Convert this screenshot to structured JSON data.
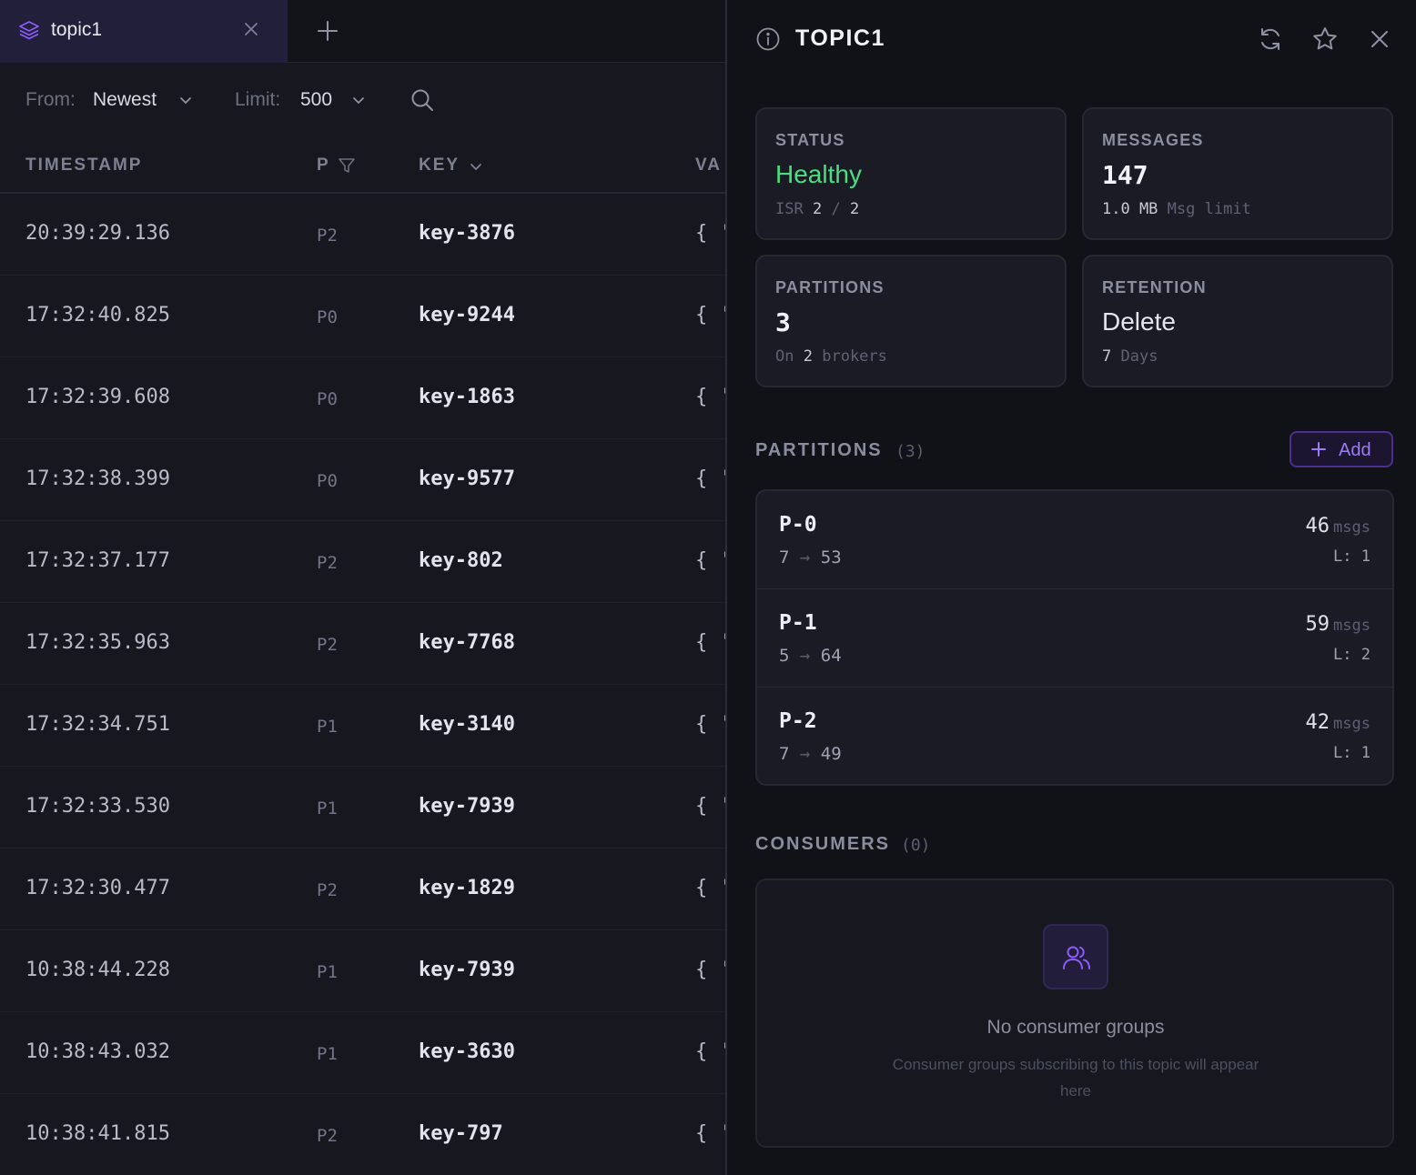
{
  "tab": {
    "label": "topic1"
  },
  "filters": {
    "from_label": "From:",
    "from_value": "Newest",
    "limit_label": "Limit:",
    "limit_value": "500"
  },
  "table": {
    "columns": [
      "TIMESTAMP",
      "P",
      "KEY",
      "VA"
    ],
    "rows": [
      {
        "timestamp": "20:39:29.136",
        "partition": "P2",
        "key": "key-3876",
        "value": "{ '"
      },
      {
        "timestamp": "17:32:40.825",
        "partition": "P0",
        "key": "key-9244",
        "value": "{ '"
      },
      {
        "timestamp": "17:32:39.608",
        "partition": "P0",
        "key": "key-1863",
        "value": "{ '"
      },
      {
        "timestamp": "17:32:38.399",
        "partition": "P0",
        "key": "key-9577",
        "value": "{ '"
      },
      {
        "timestamp": "17:32:37.177",
        "partition": "P2",
        "key": "key-802",
        "value": "{ '"
      },
      {
        "timestamp": "17:32:35.963",
        "partition": "P2",
        "key": "key-7768",
        "value": "{ '"
      },
      {
        "timestamp": "17:32:34.751",
        "partition": "P1",
        "key": "key-3140",
        "value": "{ '"
      },
      {
        "timestamp": "17:32:33.530",
        "partition": "P1",
        "key": "key-7939",
        "value": "{ '"
      },
      {
        "timestamp": "17:32:30.477",
        "partition": "P2",
        "key": "key-1829",
        "value": "{ '"
      },
      {
        "timestamp": "10:38:44.228",
        "partition": "P1",
        "key": "key-7939",
        "value": "{ '"
      },
      {
        "timestamp": "10:38:43.032",
        "partition": "P1",
        "key": "key-3630",
        "value": "{ '"
      },
      {
        "timestamp": "10:38:41.815",
        "partition": "P2",
        "key": "key-797",
        "value": "{ '"
      }
    ]
  },
  "panel": {
    "title": "TOPIC1",
    "status": {
      "label": "STATUS",
      "value": "Healthy",
      "isr_label": "ISR",
      "isr_in": "2",
      "isr_sep": "/",
      "isr_total": "2"
    },
    "messages": {
      "label": "MESSAGES",
      "value": "147",
      "limit_value": "1.0 MB",
      "limit_label": "Msg limit"
    },
    "partitions_card": {
      "label": "PARTITIONS",
      "value": "3",
      "on_label": "On",
      "brokers": "2",
      "brokers_label": "brokers"
    },
    "retention": {
      "label": "RETENTION",
      "value": "Delete",
      "days": "7",
      "days_label": "Days"
    },
    "partitions_section": {
      "title": "PARTITIONS",
      "count": "(3)",
      "add_label": "Add",
      "items": [
        {
          "name": "P-0",
          "start": "7",
          "end": "53",
          "msgs": "46",
          "msgs_label": "msgs",
          "leader": "L: 1"
        },
        {
          "name": "P-1",
          "start": "5",
          "end": "64",
          "msgs": "59",
          "msgs_label": "msgs",
          "leader": "L: 2"
        },
        {
          "name": "P-2",
          "start": "7",
          "end": "49",
          "msgs": "42",
          "msgs_label": "msgs",
          "leader": "L: 1"
        }
      ]
    },
    "consumers_section": {
      "title": "CONSUMERS",
      "count": "(0)",
      "empty_title": "No consumer groups",
      "empty_desc": "Consumer groups subscribing to this topic will appear here"
    }
  },
  "colors": {
    "accent": "#8b5cf6",
    "healthy": "#4ade80",
    "background": "#15161d",
    "panel": "#111217"
  }
}
